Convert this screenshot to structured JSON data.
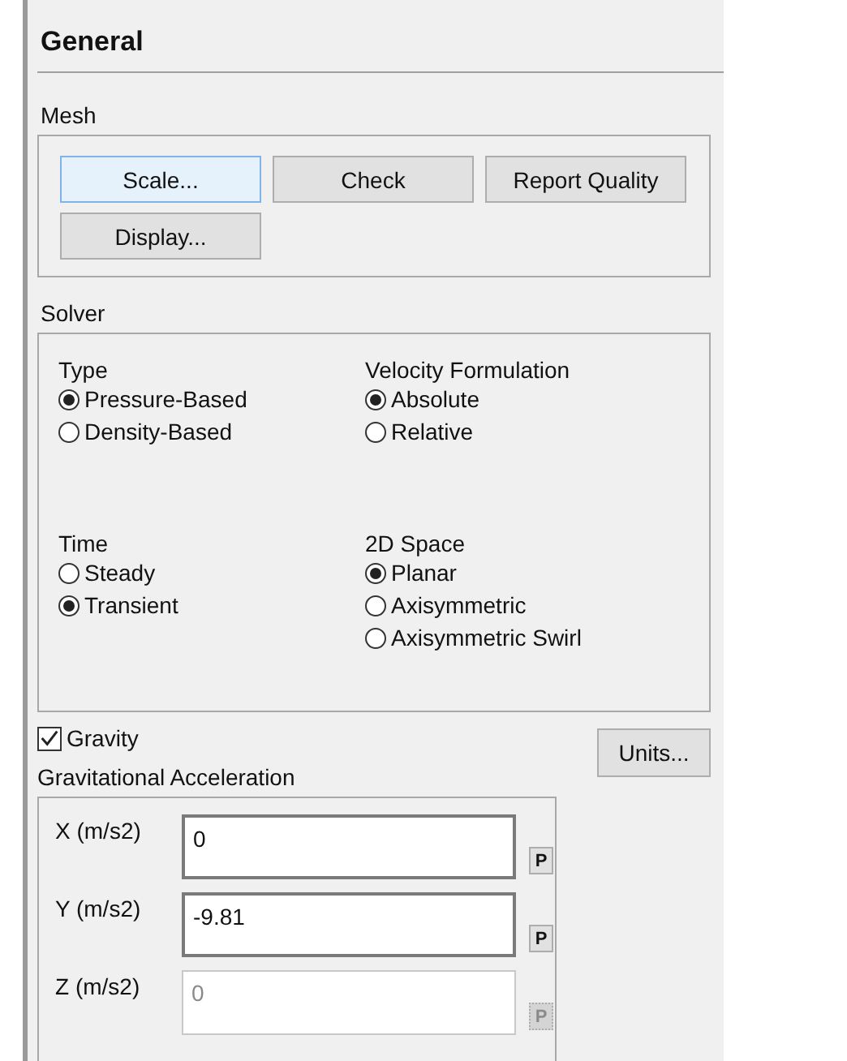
{
  "panel": {
    "title": "General"
  },
  "mesh": {
    "label": "Mesh",
    "buttons": [
      {
        "label": "Scale...",
        "focused": true
      },
      {
        "label": "Check",
        "focused": false
      },
      {
        "label": "Report Quality",
        "focused": false
      },
      {
        "label": "Display...",
        "focused": false
      }
    ]
  },
  "solver": {
    "label": "Solver",
    "groups": [
      {
        "label": "Type",
        "options": [
          {
            "label": "Pressure-Based",
            "selected": true
          },
          {
            "label": "Density-Based",
            "selected": false
          }
        ]
      },
      {
        "label": "Velocity Formulation",
        "options": [
          {
            "label": "Absolute",
            "selected": true
          },
          {
            "label": "Relative",
            "selected": false
          }
        ]
      },
      {
        "label": "Time",
        "options": [
          {
            "label": "Steady",
            "selected": false
          },
          {
            "label": "Transient",
            "selected": true
          }
        ]
      },
      {
        "label": "2D Space",
        "options": [
          {
            "label": "Planar",
            "selected": true
          },
          {
            "label": "Axisymmetric",
            "selected": false
          },
          {
            "label": "Axisymmetric Swirl",
            "selected": false
          }
        ]
      }
    ]
  },
  "gravity": {
    "label": "Gravity",
    "checked": true
  },
  "units_button": "Units...",
  "acceleration": {
    "label": "Gravitational Acceleration",
    "fields": [
      {
        "label": "X (m/s2)",
        "value": "0",
        "disabled": false,
        "parameter_button": "P"
      },
      {
        "label": "Y (m/s2)",
        "value": "-9.81",
        "disabled": false,
        "parameter_button": "P"
      },
      {
        "label": "Z (m/s2)",
        "value": "0",
        "disabled": true,
        "parameter_button": "P"
      }
    ]
  }
}
